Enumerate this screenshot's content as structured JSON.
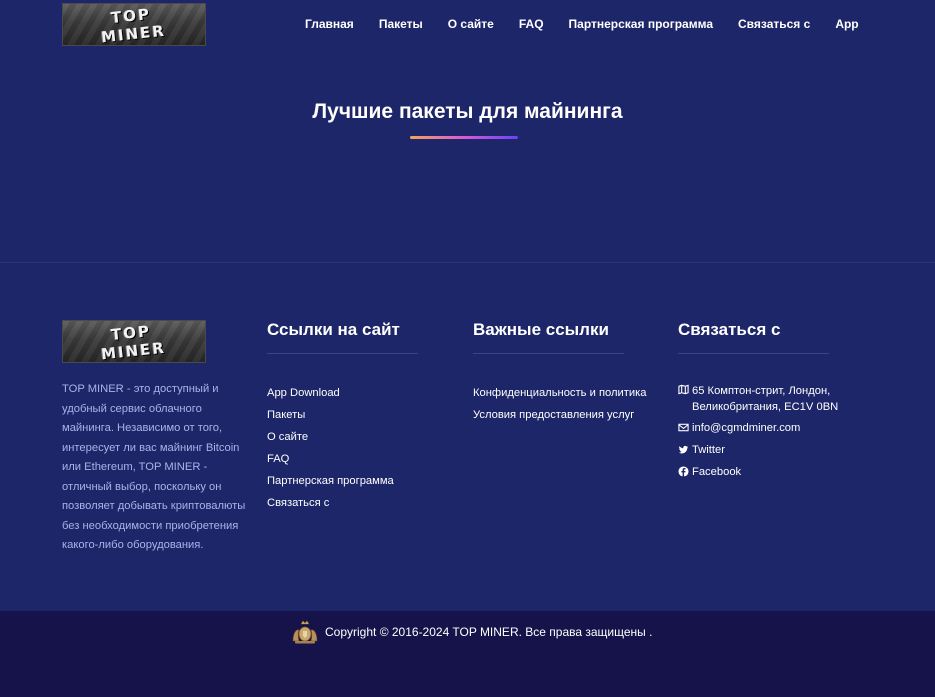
{
  "header": {
    "logo_line1": "TOP",
    "logo_line2": "MINER",
    "nav": [
      "Главная",
      "Пакеты",
      "О сайте",
      "FAQ",
      "Партнерская программа",
      "Связаться с",
      "App"
    ]
  },
  "hero": {
    "title": "Лучшие пакеты для майнинга"
  },
  "footer": {
    "about": "TOP MINER - это доступный и удобный сервис облачного майнинга. Независимо от того, интересует ли вас майнинг Bitcoin или Ethereum, TOP MINER - отличный выбор, поскольку он позволяет добывать криптовалюты без необходимости приобретения какого-либо оборудования.",
    "site_links": {
      "title": "Ссылки на сайт",
      "items": [
        "App Download",
        "Пакеты",
        "О сайте",
        "FAQ",
        "Партнерская программа",
        "Связаться с"
      ]
    },
    "important_links": {
      "title": "Важные ссылки",
      "items": [
        "Конфиденциальность и политика",
        "Условия предоставления услуг"
      ]
    },
    "contact": {
      "title": "Связаться с",
      "address": "65 Комптон-стрит, Лондон, Великобритания, EC1V 0BN",
      "email": "info@cgmdminer.com",
      "twitter": "Twitter",
      "facebook": "Facebook",
      "icons": [
        "map-icon",
        "envelope-icon",
        "twitter-icon",
        "facebook-icon"
      ]
    }
  },
  "bottom": {
    "copyright": "Copyright © 2016-2024 TOP MINER. Все права защищены ."
  },
  "colors": {
    "background": "#1d2668",
    "bottom_bar": "#15134a",
    "about_text": "#a9b3ea",
    "accent_gradient": [
      "#f4a35a",
      "#d65bd6",
      "#6a42f5"
    ]
  }
}
